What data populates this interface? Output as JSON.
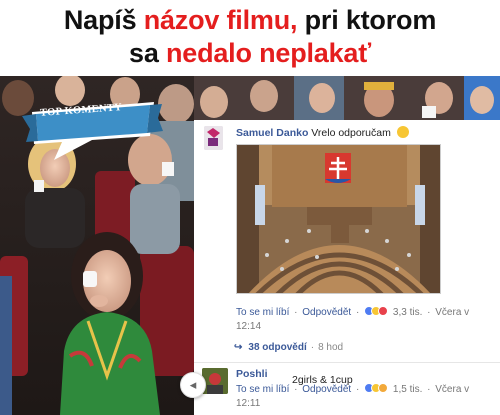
{
  "headline": {
    "line1_a": "Napíš ",
    "line1_red": "názov filmu,",
    "line1_b": " pri ktorom",
    "line2_a": "sa ",
    "line2_red": "nedalo neplakať"
  },
  "badge": {
    "label": "TOP KOMENTY"
  },
  "comment1": {
    "author": "Samuel Danko",
    "text": "Vrelo odporučam",
    "emoji_icon": "smile-emoji",
    "like_label": "To se mi líbí",
    "reply_label": "Odpovědět",
    "reactions_count": "3,3 tis.",
    "time": "Včera v 12:14"
  },
  "replies": {
    "label": "38 odpovědí",
    "time": "8 hod"
  },
  "comment2": {
    "author": "Poshli",
    "text": "2girls & 1cup",
    "like_label": "To se mi líbí",
    "reply_label": "Odpovědět",
    "reactions_count": "1,5 tis.",
    "time": "Včera v 12:11"
  },
  "colors": {
    "accent_red": "#e41e1e",
    "facebook_blue": "#3b5998",
    "badge_blue": "#3d8fc7"
  }
}
